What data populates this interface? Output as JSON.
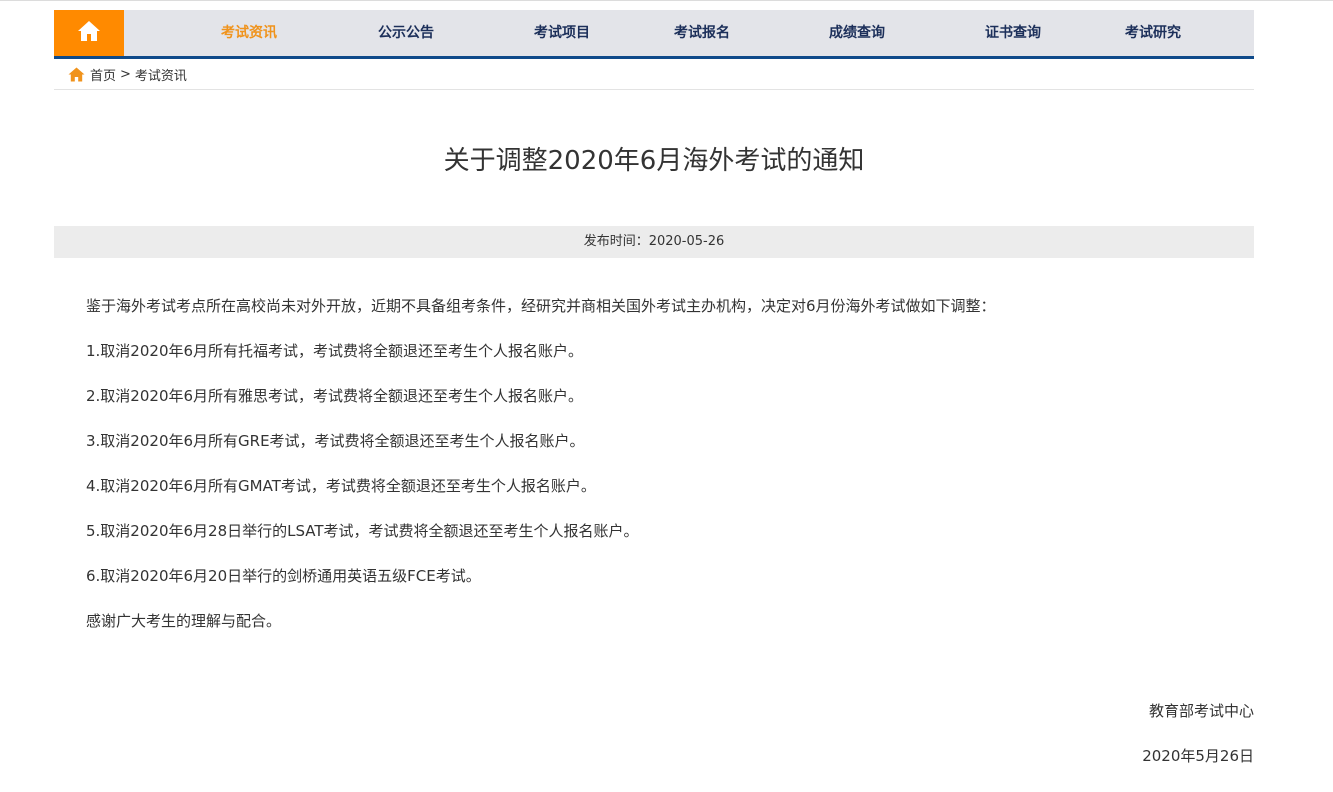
{
  "nav": {
    "home_icon": "home-icon",
    "accent": "#ff8a00",
    "active_color": "#f0931c",
    "items": [
      {
        "label": "考试资讯",
        "active": true
      },
      {
        "label": "公示公告"
      },
      {
        "label": "考试项目"
      },
      {
        "label": "考试报名"
      },
      {
        "label": "成绩查询"
      },
      {
        "label": "证书查询"
      },
      {
        "label": "考试研究"
      }
    ]
  },
  "breadcrumb": {
    "icon": "home-icon",
    "home": "首页",
    "separator": ">",
    "current": "考试资讯"
  },
  "article": {
    "title": "关于调整2020年6月海外考试的通知",
    "publish_label": "发布时间：2020-05-26",
    "paragraphs": [
      "鉴于海外考试考点所在高校尚未对外开放，近期不具备组考条件，经研究并商相关国外考试主办机构，决定对6月份海外考试做如下调整：",
      "1.取消2020年6月所有托福考试，考试费将全额退还至考生个人报名账户。",
      "2.取消2020年6月所有雅思考试，考试费将全额退还至考生个人报名账户。",
      "3.取消2020年6月所有GRE考试，考试费将全额退还至考生个人报名账户。",
      "4.取消2020年6月所有GMAT考试，考试费将全额退还至考生个人报名账户。",
      "5.取消2020年6月28日举行的LSAT考试，考试费将全额退还至考生个人报名账户。",
      "6.取消2020年6月20日举行的剑桥通用英语五级FCE考试。",
      "感谢广大考生的理解与配合。"
    ],
    "signature": "教育部考试中心",
    "date": "2020年5月26日"
  }
}
